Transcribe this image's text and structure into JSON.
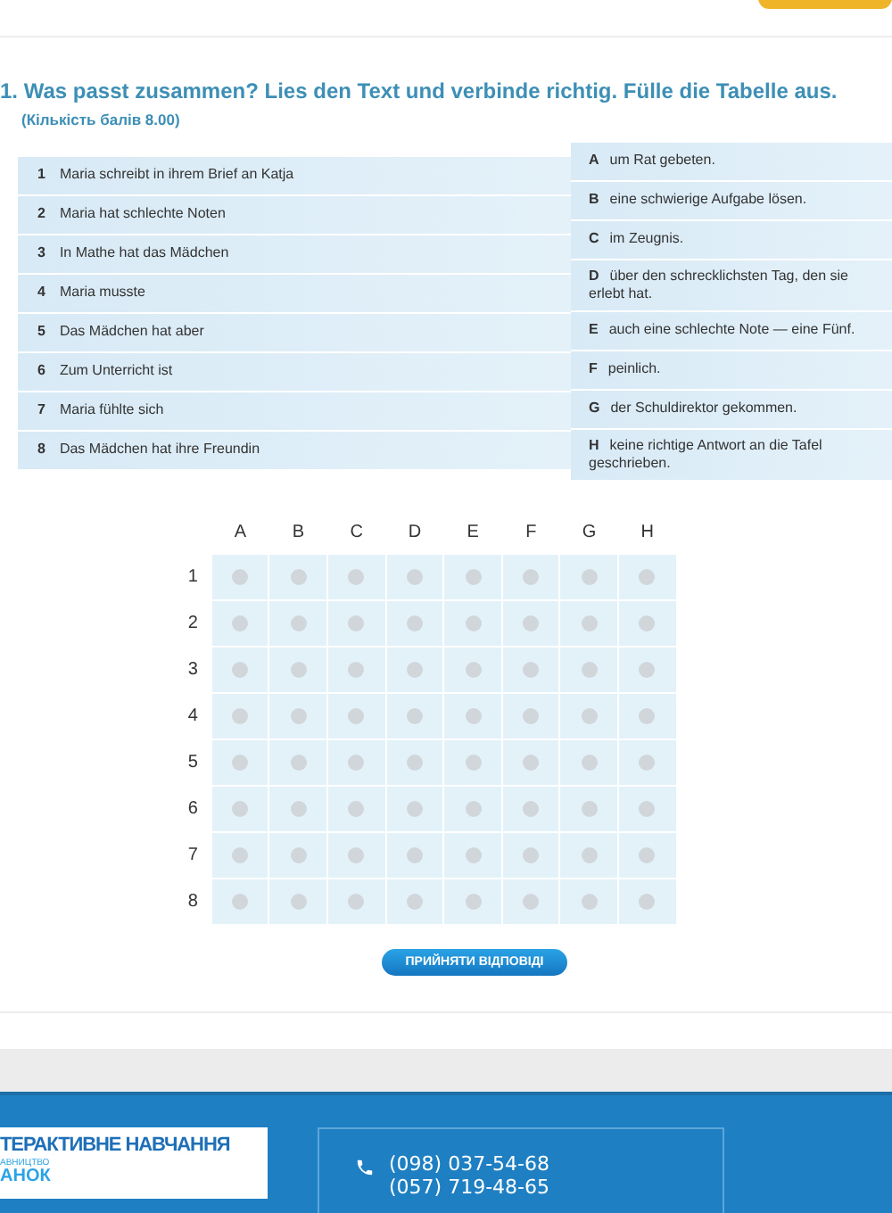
{
  "question": {
    "title": "1. Was passt zusammen? Lies den Text und verbinde richtig. Fülle die Tabelle aus.",
    "points": "(Кількість балів 8.00)"
  },
  "left_items": [
    {
      "number": "1",
      "text": "Maria schreibt in ihrem Brief an Katja"
    },
    {
      "number": "2",
      "text": "Maria hat schlechte Noten"
    },
    {
      "number": "3",
      "text": "In Mathe hat das Mädchen"
    },
    {
      "number": "4",
      "text": "Maria musste"
    },
    {
      "number": "5",
      "text": "Das Mädchen hat aber"
    },
    {
      "number": "6",
      "text": "Zum Unterricht ist"
    },
    {
      "number": "7",
      "text": "Maria fühlte sich"
    },
    {
      "number": "8",
      "text": "Das Mädchen hat ihre Freundin"
    }
  ],
  "right_items": [
    {
      "letter": "A",
      "text": "um Rat gebeten."
    },
    {
      "letter": "B",
      "text": "eine schwierige Aufgabe lösen."
    },
    {
      "letter": "C",
      "text": "im Zeugnis."
    },
    {
      "letter": "D",
      "text": "über den schrecklichsten Tag, den sie erlebt hat."
    },
    {
      "letter": "E",
      "text": "auch eine schlechte Note — eine Fünf."
    },
    {
      "letter": "F",
      "text": "peinlich."
    },
    {
      "letter": "G",
      "text": "der Schuldirektor gekommen."
    },
    {
      "letter": "H",
      "text": "keine richtige Antwort an die Tafel geschrieben."
    }
  ],
  "grid": {
    "columns": [
      "A",
      "B",
      "C",
      "D",
      "E",
      "F",
      "G",
      "H"
    ],
    "rows": [
      {
        "label": "1",
        "selected": [
          false,
          false,
          false,
          false,
          false,
          false,
          false,
          false
        ]
      },
      {
        "label": "2",
        "selected": [
          false,
          false,
          false,
          false,
          false,
          false,
          false,
          false
        ]
      },
      {
        "label": "3",
        "selected": [
          false,
          false,
          false,
          false,
          false,
          false,
          false,
          false
        ]
      },
      {
        "label": "4",
        "selected": [
          false,
          false,
          false,
          false,
          false,
          false,
          false,
          false
        ]
      },
      {
        "label": "5",
        "selected": [
          false,
          false,
          false,
          false,
          false,
          false,
          false,
          false
        ]
      },
      {
        "label": "6",
        "selected": [
          false,
          false,
          false,
          false,
          false,
          false,
          false,
          false
        ]
      },
      {
        "label": "7",
        "selected": [
          false,
          false,
          false,
          false,
          false,
          false,
          false,
          false
        ]
      },
      {
        "label": "8",
        "selected": [
          false,
          false,
          false,
          false,
          false,
          false,
          false,
          false
        ]
      }
    ]
  },
  "submit_button": "ПРИЙНЯТИ ВІДПОВІДІ",
  "footer": {
    "logo_title": "ТЕРАКТИВНЕ НАВЧАННЯ",
    "logo_small": "АВНИЦТВО",
    "logo_brand": "АНОК",
    "phones": [
      "(098) 037-54-68",
      "(057) 719-48-65"
    ]
  }
}
